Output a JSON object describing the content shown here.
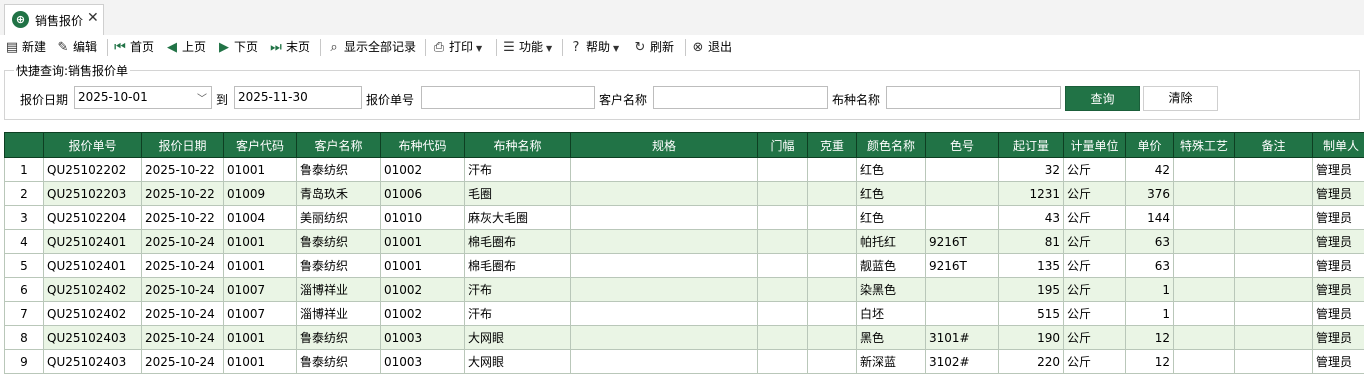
{
  "tab": {
    "title": "销售报价",
    "close": "✕",
    "icon": "grid-globe-icon"
  },
  "toolbar": {
    "new": "新建",
    "edit": "编辑",
    "first": "首页",
    "prev": "上页",
    "next": "下页",
    "last": "末页",
    "show_all": "显示全部记录",
    "print": "打印",
    "functions": "功能",
    "help": "帮助",
    "refresh": "刷新",
    "exit": "退出"
  },
  "query": {
    "title": "快捷查询:销售报价单",
    "date_label": "报价日期",
    "date_from": "2025-10-01",
    "to_label": "到",
    "date_to": "2025-11-30",
    "quote_no_label": "报价单号",
    "quote_no_value": "",
    "customer_label": "客户名称",
    "customer_value": "",
    "fabric_label": "布种名称",
    "fabric_value": "",
    "query_btn": "查询",
    "clear_btn": "清除"
  },
  "table": {
    "headers": [
      "",
      "报价单号",
      "报价日期",
      "客户代码",
      "客户名称",
      "布种代码",
      "布种名称",
      "规格",
      "门幅",
      "克重",
      "颜色名称",
      "色号",
      "起订量",
      "计量单位",
      "单价",
      "特殊工艺",
      "备注",
      "制单人"
    ],
    "rows": [
      [
        "1",
        "QU25102202",
        "2025-10-22",
        "01001",
        "鲁泰纺织",
        "01002",
        "汗布",
        "",
        "",
        "",
        "红色",
        "",
        "32",
        "公斤",
        "42",
        "",
        "",
        "管理员"
      ],
      [
        "2",
        "QU25102203",
        "2025-10-22",
        "01009",
        "青岛玖禾",
        "01006",
        "毛圈",
        "",
        "",
        "",
        "红色",
        "",
        "1231",
        "公斤",
        "376",
        "",
        "",
        "管理员"
      ],
      [
        "3",
        "QU25102204",
        "2025-10-22",
        "01004",
        "美丽纺织",
        "01010",
        "麻灰大毛圈",
        "",
        "",
        "",
        "红色",
        "",
        "43",
        "公斤",
        "144",
        "",
        "",
        "管理员"
      ],
      [
        "4",
        "QU25102401",
        "2025-10-24",
        "01001",
        "鲁泰纺织",
        "01001",
        "棉毛圈布",
        "",
        "",
        "",
        "帕托红",
        "9216T",
        "81",
        "公斤",
        "63",
        "",
        "",
        "管理员"
      ],
      [
        "5",
        "QU25102401",
        "2025-10-24",
        "01001",
        "鲁泰纺织",
        "01001",
        "棉毛圈布",
        "",
        "",
        "",
        "靓蓝色",
        "9216T",
        "135",
        "公斤",
        "63",
        "",
        "",
        "管理员"
      ],
      [
        "6",
        "QU25102402",
        "2025-10-24",
        "01007",
        "淄博祥业",
        "01002",
        "汗布",
        "",
        "",
        "",
        "染黑色",
        "",
        "195",
        "公斤",
        "1",
        "",
        "",
        "管理员"
      ],
      [
        "7",
        "QU25102402",
        "2025-10-24",
        "01007",
        "淄博祥业",
        "01002",
        "汗布",
        "",
        "",
        "",
        "白坯",
        "",
        "515",
        "公斤",
        "1",
        "",
        "",
        "管理员"
      ],
      [
        "8",
        "QU25102403",
        "2025-10-24",
        "01001",
        "鲁泰纺织",
        "01003",
        "大网眼",
        "",
        "",
        "",
        "黑色",
        "3101#",
        "190",
        "公斤",
        "12",
        "",
        "",
        "管理员"
      ],
      [
        "9",
        "QU25102403",
        "2025-10-24",
        "01001",
        "鲁泰纺织",
        "01003",
        "大网眼",
        "",
        "",
        "",
        "新深蓝",
        "3102#",
        "220",
        "公斤",
        "12",
        "",
        "",
        "管理员"
      ]
    ]
  },
  "colors": {
    "accent": "#217346",
    "row_alt": "#eaf5e5"
  }
}
